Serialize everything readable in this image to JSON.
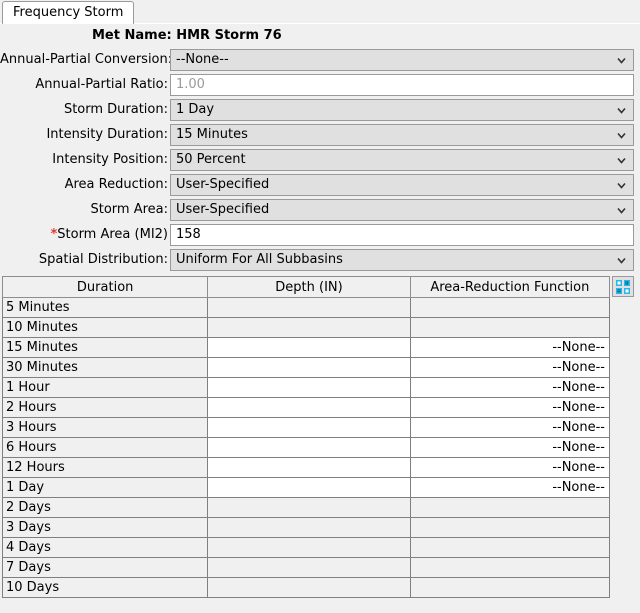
{
  "window": {
    "tab_label": "Frequency Storm"
  },
  "header": {
    "met_name_label": "Met Name:",
    "met_name_value": "HMR Storm 76",
    "met_name_full": "Met Name: HMR Storm 76"
  },
  "form": {
    "fields": [
      {
        "label": "Annual-Partial Conversion:",
        "value": "--None--",
        "type": "combo",
        "disabled": false,
        "required": false,
        "name": "annual-partial-conversion"
      },
      {
        "label": "Annual-Partial Ratio:",
        "value": "1.00",
        "type": "text",
        "disabled": true,
        "required": false,
        "name": "annual-partial-ratio"
      },
      {
        "label": "Storm Duration:",
        "value": "1 Day",
        "type": "combo",
        "disabled": false,
        "required": false,
        "name": "storm-duration"
      },
      {
        "label": "Intensity Duration:",
        "value": "15 Minutes",
        "type": "combo",
        "disabled": false,
        "required": false,
        "name": "intensity-duration"
      },
      {
        "label": "Intensity Position:",
        "value": "50 Percent",
        "type": "combo",
        "disabled": false,
        "required": false,
        "name": "intensity-position"
      },
      {
        "label": "Area Reduction:",
        "value": "User-Specified",
        "type": "combo",
        "disabled": false,
        "required": false,
        "name": "area-reduction"
      },
      {
        "label": "Storm Area:",
        "value": "User-Specified",
        "type": "combo",
        "disabled": false,
        "required": false,
        "name": "storm-area"
      },
      {
        "label": "Storm Area (MI2)",
        "value": "158",
        "type": "text",
        "disabled": false,
        "required": true,
        "name": "storm-area-mi2"
      },
      {
        "label": "Spatial Distribution:",
        "value": "Uniform For All Subbasins",
        "type": "combo",
        "disabled": false,
        "required": false,
        "name": "spatial-distribution"
      }
    ]
  },
  "table": {
    "columns": [
      "Duration",
      "Depth (IN)",
      "Area-Reduction Function"
    ],
    "rows": [
      {
        "duration": "5 Minutes",
        "depth": "",
        "arf": "",
        "depth_enabled": false,
        "arf_enabled": false
      },
      {
        "duration": "10 Minutes",
        "depth": "",
        "arf": "",
        "depth_enabled": false,
        "arf_enabled": false
      },
      {
        "duration": "15 Minutes",
        "depth": "",
        "arf": "--None--",
        "depth_enabled": true,
        "arf_enabled": true
      },
      {
        "duration": "30 Minutes",
        "depth": "",
        "arf": "--None--",
        "depth_enabled": true,
        "arf_enabled": true
      },
      {
        "duration": "1 Hour",
        "depth": "",
        "arf": "--None--",
        "depth_enabled": true,
        "arf_enabled": true
      },
      {
        "duration": "2 Hours",
        "depth": "",
        "arf": "--None--",
        "depth_enabled": true,
        "arf_enabled": true
      },
      {
        "duration": "3 Hours",
        "depth": "",
        "arf": "--None--",
        "depth_enabled": true,
        "arf_enabled": true
      },
      {
        "duration": "6 Hours",
        "depth": "",
        "arf": "--None--",
        "depth_enabled": true,
        "arf_enabled": true
      },
      {
        "duration": "12 Hours",
        "depth": "",
        "arf": "--None--",
        "depth_enabled": true,
        "arf_enabled": true
      },
      {
        "duration": "1 Day",
        "depth": "",
        "arf": "--None--",
        "depth_enabled": true,
        "arf_enabled": true
      },
      {
        "duration": "2 Days",
        "depth": "",
        "arf": "",
        "depth_enabled": false,
        "arf_enabled": false
      },
      {
        "duration": "3 Days",
        "depth": "",
        "arf": "",
        "depth_enabled": false,
        "arf_enabled": false
      },
      {
        "duration": "4 Days",
        "depth": "",
        "arf": "",
        "depth_enabled": false,
        "arf_enabled": false
      },
      {
        "duration": "7 Days",
        "depth": "",
        "arf": "",
        "depth_enabled": false,
        "arf_enabled": false
      },
      {
        "duration": "10 Days",
        "depth": "",
        "arf": "",
        "depth_enabled": false,
        "arf_enabled": false
      }
    ],
    "grid_button_icon": "table-grid-icon"
  },
  "colors": {
    "panel_bg": "#f0f0f0",
    "field_bg": "#e0e0e0",
    "input_bg": "#ffffff",
    "border": "#9a9a9a",
    "grid_line": "#7f7f7f",
    "required_star": "#e03b2f",
    "disabled_text": "#9b9b9b",
    "icon_blue": "#29b6e8"
  }
}
